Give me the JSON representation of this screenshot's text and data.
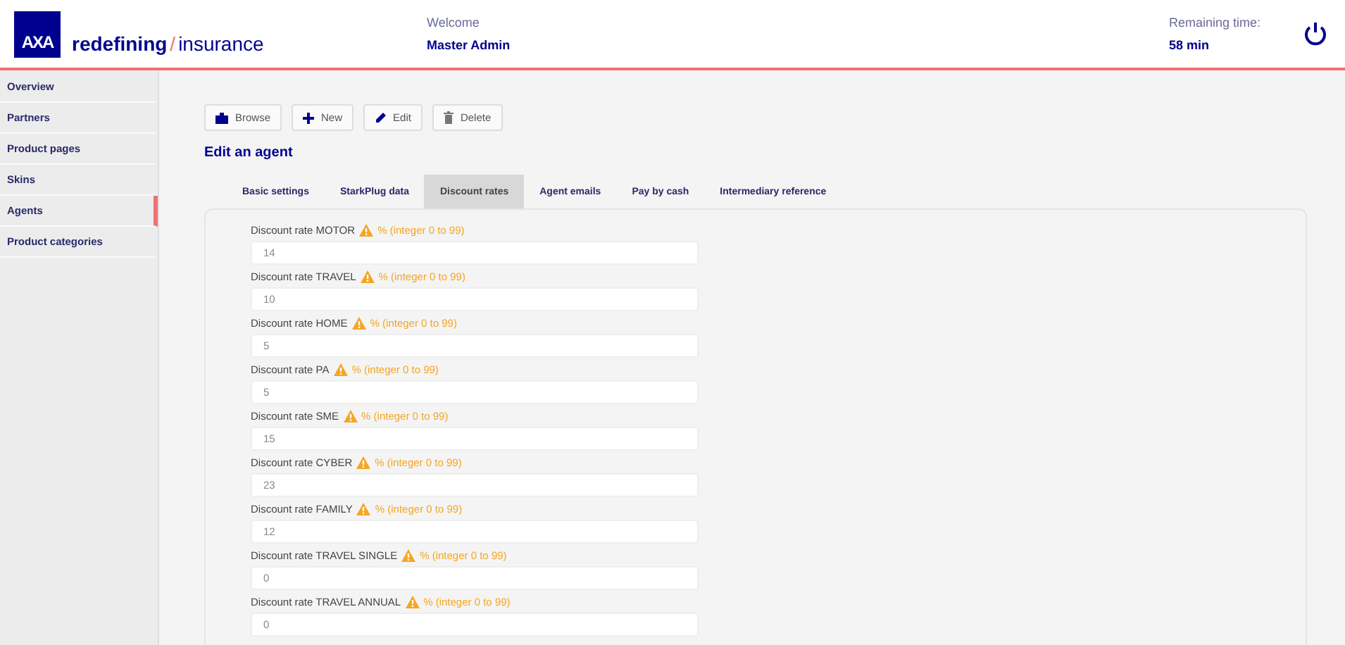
{
  "header": {
    "logo": "AXA",
    "tagline_bold": "redefining",
    "tagline_slash": "/",
    "tagline_light": "insurance",
    "welcome": "Welcome",
    "user": "Master Admin",
    "remaining_label": "Remaining time:",
    "remaining_value": "58 min"
  },
  "sidebar": {
    "items": [
      {
        "label": "Overview",
        "selected": false
      },
      {
        "label": "Partners",
        "selected": false
      },
      {
        "label": "Product pages",
        "selected": false
      },
      {
        "label": "Skins",
        "selected": false
      },
      {
        "label": "Agents",
        "selected": true
      },
      {
        "label": "Product categories",
        "selected": false
      }
    ]
  },
  "toolbar": [
    {
      "kind": "browse",
      "label": "Browse"
    },
    {
      "kind": "new",
      "label": "New"
    },
    {
      "kind": "edit",
      "label": "Edit"
    },
    {
      "kind": "delete",
      "label": "Delete"
    }
  ],
  "heading": "Edit an agent",
  "tabs": [
    {
      "label": "Basic settings",
      "selected": false
    },
    {
      "label": "StarkPlug data",
      "selected": false
    },
    {
      "label": "Discount rates",
      "selected": true
    },
    {
      "label": "Agent emails",
      "selected": false
    },
    {
      "label": "Pay by cash",
      "selected": false
    },
    {
      "label": "Intermediary reference",
      "selected": false
    }
  ],
  "fields": [
    {
      "label": "Discount rate MOTOR",
      "hint": "% (integer 0 to 99)",
      "value": "14"
    },
    {
      "label": "Discount rate TRAVEL",
      "hint": "% (integer 0 to 99)",
      "value": "10"
    },
    {
      "label": "Discount rate HOME",
      "hint": "% (integer 0 to 99)",
      "value": "5"
    },
    {
      "label": "Discount rate PA",
      "hint": "% (integer 0 to 99)",
      "value": "5"
    },
    {
      "label": "Discount rate SME",
      "hint": "% (integer 0 to 99)",
      "value": "15"
    },
    {
      "label": "Discount rate CYBER",
      "hint": "% (integer 0 to 99)",
      "value": "23"
    },
    {
      "label": "Discount rate FAMILY",
      "hint": "% (integer 0 to 99)",
      "value": "12"
    },
    {
      "label": "Discount rate TRAVEL SINGLE",
      "hint": "% (integer 0 to 99)",
      "value": "0"
    },
    {
      "label": "Discount rate TRAVEL ANNUAL",
      "hint": "% (integer 0 to 99)",
      "value": "0"
    }
  ]
}
